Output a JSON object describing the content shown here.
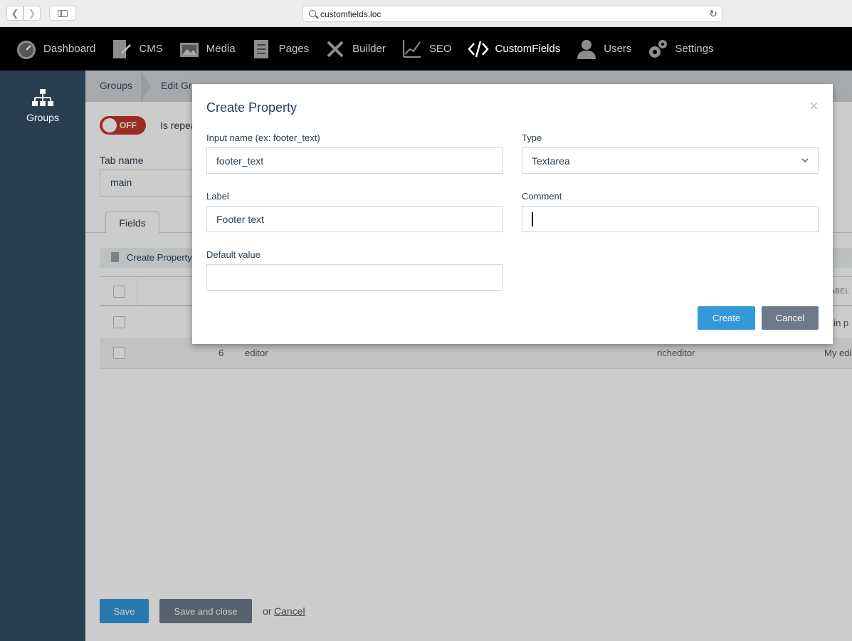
{
  "browser": {
    "url": "customfields.loc",
    "back_icon": "chevron-left-icon",
    "forward_icon": "chevron-right-icon",
    "reload_icon": "reload-icon"
  },
  "nav": {
    "items": [
      {
        "label": "Dashboard",
        "icon": "speedometer-icon"
      },
      {
        "label": "CMS",
        "icon": "cms-icon"
      },
      {
        "label": "Media",
        "icon": "media-icon"
      },
      {
        "label": "Pages",
        "icon": "pages-icon"
      },
      {
        "label": "Builder",
        "icon": "builder-icon"
      },
      {
        "label": "SEO",
        "icon": "seo-icon"
      },
      {
        "label": "CustomFields",
        "icon": "code-icon",
        "active": true
      },
      {
        "label": "Users",
        "icon": "user-icon"
      },
      {
        "label": "Settings",
        "icon": "gear-icon"
      }
    ]
  },
  "sidebar": {
    "items": [
      {
        "label": "Groups",
        "icon": "sitemap-icon"
      }
    ]
  },
  "breadcrumb": {
    "items": [
      "Groups",
      "Edit Gr"
    ]
  },
  "form": {
    "toggle_text": "OFF",
    "repeater_label": "Is repea",
    "tab_name_label": "Tab name",
    "tab_name_value": "main"
  },
  "tabs": {
    "items": [
      "Fields"
    ]
  },
  "toolbar": {
    "create_label": "Create Property"
  },
  "grid": {
    "header_partial": "ABEL",
    "rows": [
      {
        "id": "",
        "name": "",
        "type": "",
        "label": "ain p"
      },
      {
        "id": "6",
        "name": "editor",
        "type": "richeditor",
        "label": "My edi"
      }
    ]
  },
  "footer": {
    "save_label": "Save",
    "save_close_label": "Save and close",
    "or_text": "or",
    "cancel_label": "Cancel"
  },
  "modal": {
    "title": "Create Property",
    "close_symbol": "×",
    "input_name_label": "Input name (ex: footer_text)",
    "input_name_value": "footer_text",
    "type_label": "Type",
    "type_value": "Textarea",
    "label_label": "Label",
    "label_value": "Footer text",
    "comment_label": "Comment",
    "comment_value": "",
    "default_label": "Default value",
    "default_value": "",
    "create_label": "Create",
    "cancel_label": "Cancel"
  },
  "colors": {
    "primary": "#3498db",
    "secondary": "#6c7a89",
    "sidebar": "#2a3e51",
    "toggle_off": "#c0392b"
  }
}
